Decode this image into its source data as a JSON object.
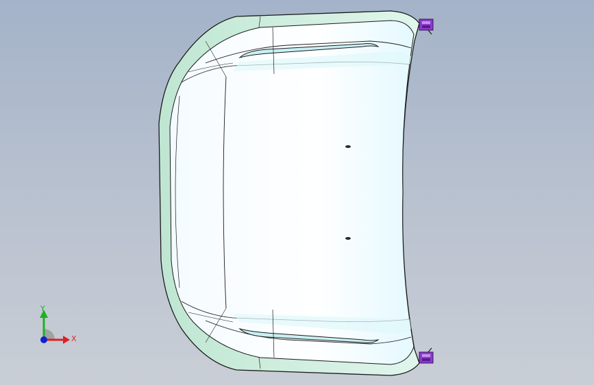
{
  "viewport": {
    "background_top": "#a4b3c9",
    "background_bottom": "#c9ced6"
  },
  "model": {
    "part": "hood-panel",
    "surface_color": "#ffffff",
    "edge_band_color": "#d6f2e6",
    "highlight_color": "#e8fbff",
    "outline_color": "#1a1a1a",
    "hinge_color": "#8a3ec8"
  },
  "triad": {
    "x_label": "X",
    "y_label": "Y",
    "x_color": "#e02020",
    "y_color": "#20b020",
    "z_color": "#1020d0"
  }
}
